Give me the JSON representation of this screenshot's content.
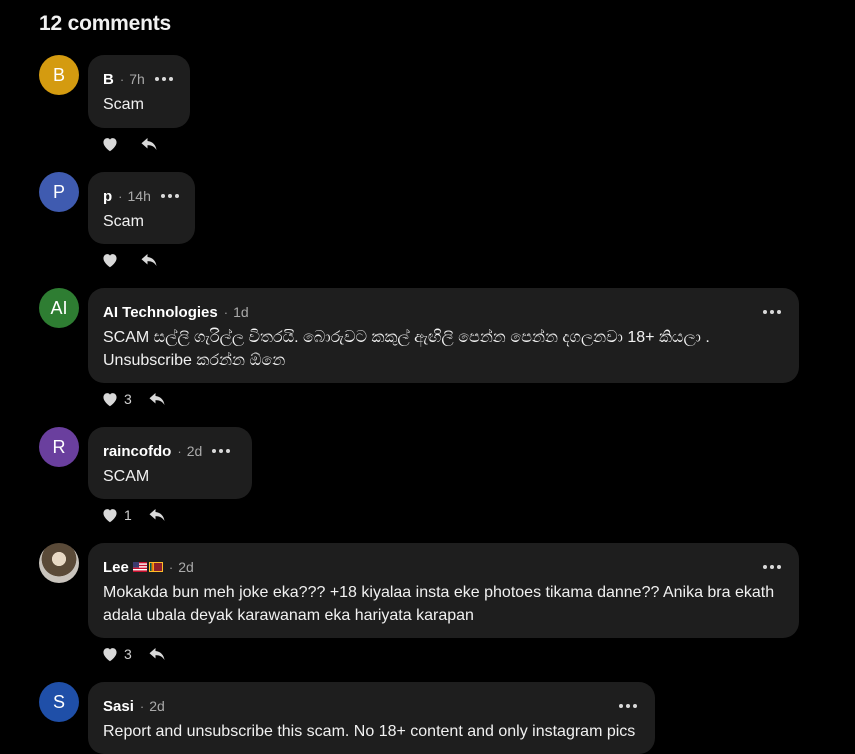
{
  "header": {
    "title": "12 comments"
  },
  "comments": [
    {
      "avatar_letter": "B",
      "avatar_color": "#d49b10",
      "author": "B",
      "time": "7h",
      "text": "Scam",
      "likes": ""
    },
    {
      "avatar_letter": "P",
      "avatar_color": "#3f5bb0",
      "author": "p",
      "time": "14h",
      "text": "Scam",
      "likes": ""
    },
    {
      "avatar_letter": "AI",
      "avatar_color": "#2e7d32",
      "author": "AI Technologies",
      "time": "1d",
      "text": "SCAM සල්ලි ගැරිල්ල විතරයි. බොරුවට කකුල් ඇඟිලි පෙන්න පෙන්න දගලනවා 18+ කියලා . Unsubscribe කරන්න ඕනෙ",
      "likes": "3"
    },
    {
      "avatar_letter": "R",
      "avatar_color": "#6a3f9e",
      "author": "raincofdo",
      "time": "2d",
      "text": "SCAM",
      "likes": "1"
    },
    {
      "avatar_letter": "",
      "avatar_color": "#6b5a3e",
      "author": "Lee",
      "time": "2d",
      "text": "Mokakda bun meh joke eka??? +18 kiyalaa insta eke photoes tikama danne?? Anika bra ekath adala ubala deyak karawanam eka hariyata karapan",
      "likes": "3"
    },
    {
      "avatar_letter": "S",
      "avatar_color": "#1f4fa8",
      "author": "Sasi",
      "time": "2d",
      "text": "Report and unsubscribe this scam. No 18+ content and only instagram pics",
      "likes": ""
    }
  ]
}
